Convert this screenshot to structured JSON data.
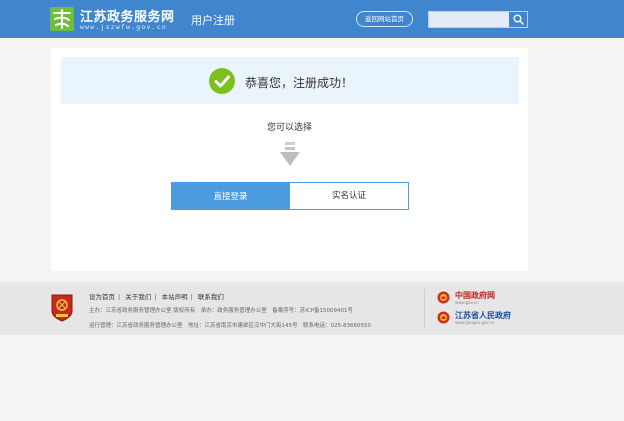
{
  "header": {
    "site_name": "江苏政务服务网",
    "site_domain": "www.jszwfw.gov.cn",
    "page_title": "用户注册",
    "home_button": "返回网站首页",
    "search_placeholder": "",
    "brand_color": "#3f86cf",
    "icons": {
      "logo": "su-logo-icon",
      "search": "search-icon"
    }
  },
  "main": {
    "success_message": "恭喜您，注册成功！",
    "choose_prompt": "您可以选择",
    "buttons": {
      "login": "直接登录",
      "verify": "实名认证"
    },
    "accent_color": "#4a9be0",
    "success_color": "#7cc020",
    "icons": {
      "success": "check-circle-icon",
      "arrow": "down-arrow-icon"
    }
  },
  "footer": {
    "links": [
      "设为首页",
      "关于我们",
      "本站声明",
      "联系我们"
    ],
    "line1": "主办：江苏省政务服务管理办公室 版权所有　承办：政务服务管理办公室　备案序号：苏ICP备15009401号",
    "line2": "运行管理：江苏省政务服务管理办公室　地址：江苏省南京市建邺区汉中门大街145号　联系电话：025-83660550",
    "gov_sites": [
      {
        "name": "中国政府网",
        "url": "www.gov.cn"
      },
      {
        "name": "江苏省人民政府",
        "url": "www.jiangsu.gov.cn"
      }
    ],
    "icons": {
      "emblem": "party-emblem-icon",
      "gov_badge": "national-emblem-icon"
    }
  }
}
